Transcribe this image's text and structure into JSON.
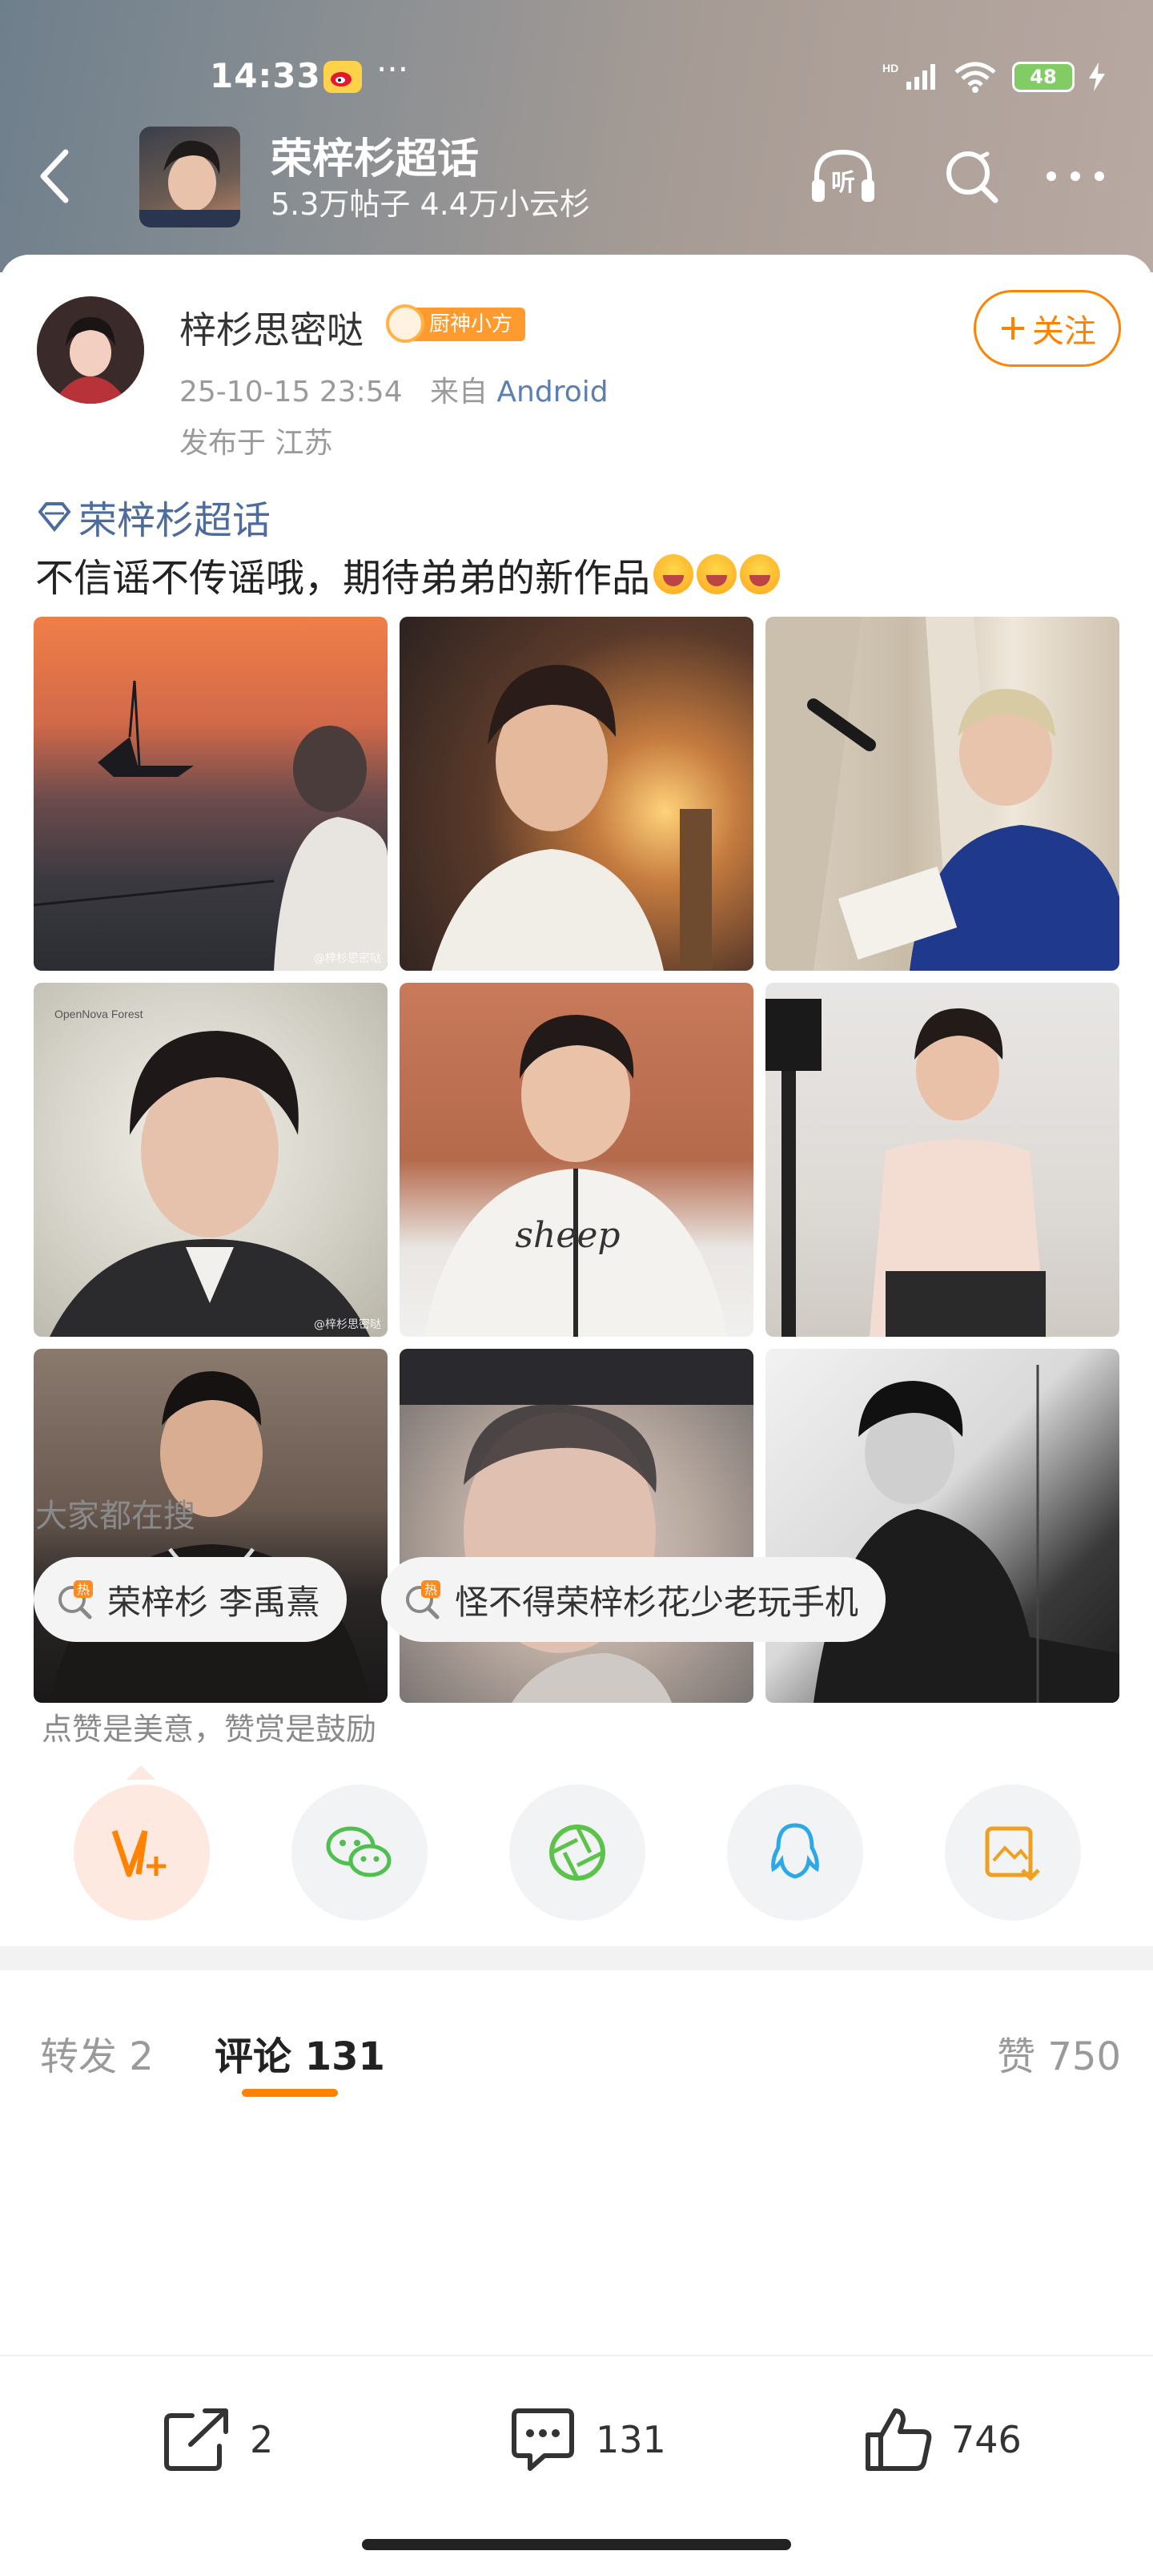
{
  "status_bar": {
    "time": "14:33",
    "dots": "···",
    "network": "HD",
    "battery": "48"
  },
  "header": {
    "topic_title": "荣梓杉超话",
    "topic_stats": "5.3万帖子 4.4万小云杉",
    "listen_label": "听"
  },
  "post": {
    "author_name": "梓杉思密哒",
    "badge_label": "厨神小方",
    "follow_label": "关注",
    "timestamp": "25-10-15 23:54",
    "source_prefix": "来自",
    "source": "Android",
    "location": "发布于 江苏",
    "topic_link": "荣梓杉超话",
    "text": "不信谣不传谣哦，期待弟弟的新作品",
    "image_watermark": "@梓杉思密哒",
    "photo5_text": "sheep",
    "photo4_corner_text": "OpenNova Forest"
  },
  "search": {
    "title": "大家都在搜",
    "chips": [
      {
        "label": "荣梓杉 李禹熹",
        "hot": "热"
      },
      {
        "label": "怪不得荣梓杉花少老玩手机",
        "hot": "热"
      }
    ]
  },
  "support": {
    "text": "点赞是美意，赞赏是鼓励"
  },
  "tabs": {
    "repost_label": "转发 2",
    "comment_label": "评论 131",
    "like_label": "赞 750"
  },
  "bottom_bar": {
    "repost_count": "2",
    "comment_count": "131",
    "like_count": "746"
  },
  "colors": {
    "accent": "#ff8200",
    "link": "#4c6c9d"
  }
}
